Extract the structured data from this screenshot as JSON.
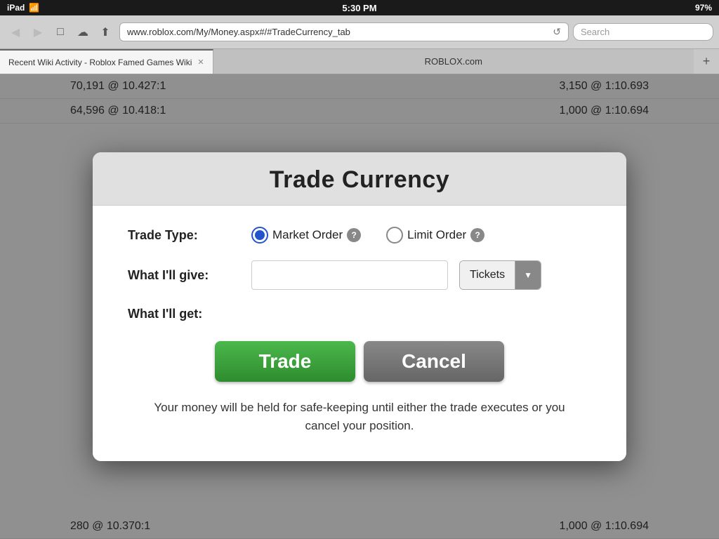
{
  "statusBar": {
    "device": "iPad",
    "wifi": "wifi",
    "time": "5:30 PM",
    "battery": "97%"
  },
  "browser": {
    "back_label": "◀",
    "forward_label": "▶",
    "bookmarks_label": "□",
    "cloud_label": "☁",
    "share_label": "⬆",
    "address": "www.roblox.com/My/Money.aspx#/#TradeCurrency_tab",
    "refresh_label": "↺",
    "search_placeholder": "Search",
    "tab1_label": "Recent Wiki Activity - Roblox Famed Games Wiki",
    "tab2_label": "ROBLOX.com",
    "new_tab_label": "+"
  },
  "backgroundTable": {
    "row1_left": "70,191 @ 10.427:1",
    "row1_right": "3,150 @ 1:10.693",
    "row2_left": "64,596 @ 10.418:1",
    "row2_right": "1,000 @ 1:10.694"
  },
  "modal": {
    "title": "Trade Currency",
    "tradeTypeLabel": "Trade Type:",
    "marketOrderLabel": "Market Order",
    "limitOrderLabel": "Limit Order",
    "whatIllGiveLabel": "What I'll give:",
    "whatIllGetLabel": "What I'll get:",
    "dropdownLabel": "Tickets",
    "tradeButton": "Trade",
    "cancelButton": "Cancel",
    "footerText": "Your money will be held for safe-keeping until either the trade executes or you cancel your position.",
    "helpIcon": "?",
    "dropdownArrow": "▼",
    "giveInputValue": "",
    "giveInputPlaceholder": ""
  },
  "bottomTable": {
    "row1_left": "280 @ 10.370:1",
    "row1_right": "1,000 @ 1:10.694"
  }
}
